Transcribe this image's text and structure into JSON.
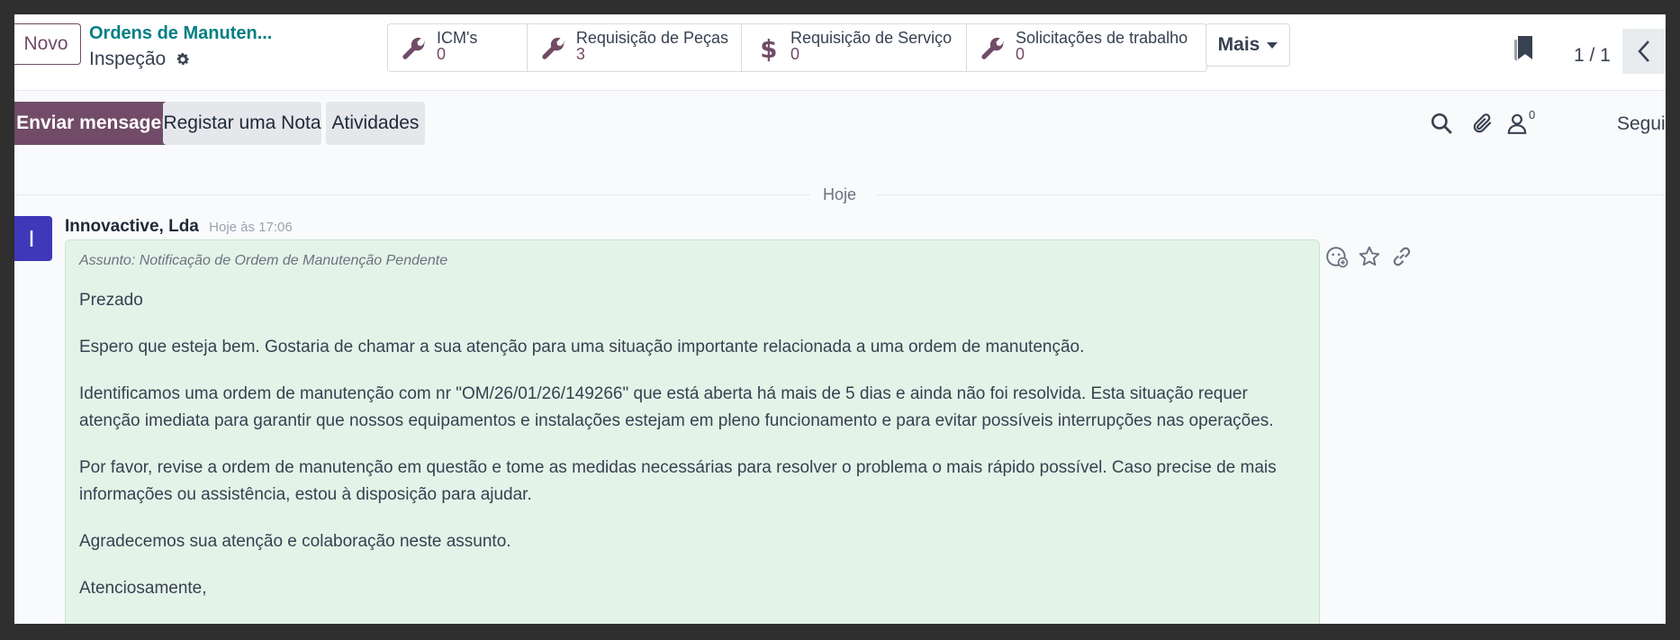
{
  "control_panel": {
    "new_button": "Novo",
    "breadcrumb_parent": "Ordens de Manuten...",
    "breadcrumb_current": "Inspeção",
    "stat_buttons": [
      {
        "label": "ICM's",
        "value": "0",
        "icon": "wrench-icon"
      },
      {
        "label": "Requisição de Peças",
        "value": "3",
        "icon": "wrench-icon"
      },
      {
        "label": "Requisição de Serviço",
        "value": "0",
        "icon": "dollar-icon"
      },
      {
        "label": "Solicitações de trabalho",
        "value": "0",
        "icon": "wrench-icon"
      }
    ],
    "more_button": "Mais",
    "pager": "1 / 1"
  },
  "chatter": {
    "send_message": "Enviar mensagem",
    "log_note": "Registar uma Nota",
    "activities": "Atividades",
    "followers_count": "0",
    "follow_label": "Seguir",
    "day_separator": "Hoje",
    "message": {
      "avatar_initial": "I",
      "author": "Innovactive, Lda",
      "date": "Hoje às 17:06",
      "subject": "Assunto: Notificação de Ordem de Manutenção Pendente",
      "paragraphs": [
        "Prezado",
        "Espero que esteja bem. Gostaria de chamar a sua atenção para uma situação importante relacionada a uma ordem de manutenção.",
        "Identificamos uma ordem de manutenção com nr \"OM/26/01/26/149266\" que está aberta há mais de 5 dias e ainda não foi resolvida. Esta situação requer atenção imediata para garantir que nossos equipamentos e instalações estejam em pleno funcionamento e para evitar possíveis interrupções nas operações.",
        "Por favor, revise a ordem de manutenção em questão e tome as medidas necessárias para resolver o problema o mais rápido possível. Caso precise de mais informações ou assistência, estou à disposição para ajudar.",
        "Agradecemos sua atenção e colaboração neste assunto.",
        "Atenciosamente,"
      ]
    }
  },
  "colors": {
    "primary": "#714b67",
    "link": "#017e84",
    "avatar": "#3f38b8",
    "message_bg": "#e4f3e8"
  }
}
